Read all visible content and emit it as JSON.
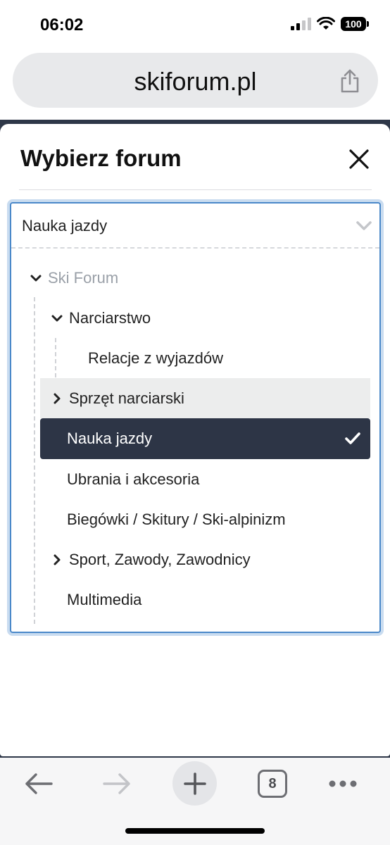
{
  "status_bar": {
    "time": "06:02",
    "battery": "100"
  },
  "browser": {
    "url": "skiforum.pl",
    "open_tabs": "8",
    "icons": [
      "share-icon",
      "back-arrow-icon",
      "forward-arrow-icon",
      "plus-icon",
      "tabs-icon",
      "more-icon"
    ]
  },
  "modal": {
    "title": "Wybierz forum"
  },
  "select": {
    "value": "Nauka jazdy"
  },
  "tree": {
    "root": "Ski Forum",
    "group": "Narciarstwo",
    "items": [
      "Relacje z wyjazdów",
      "Sprzęt narciarski",
      "Nauka jazdy",
      "Ubrania i akcesoria",
      "Biegówki / Skitury / Ski-alpinizm",
      "Sport, Zawody, Zawodnicy",
      "Multimedia"
    ]
  },
  "colors": {
    "selected_row": "#2d3546",
    "hover_row": "#eceded",
    "focus_border": "#4a88c9",
    "muted_text": "#9aa0a8"
  }
}
